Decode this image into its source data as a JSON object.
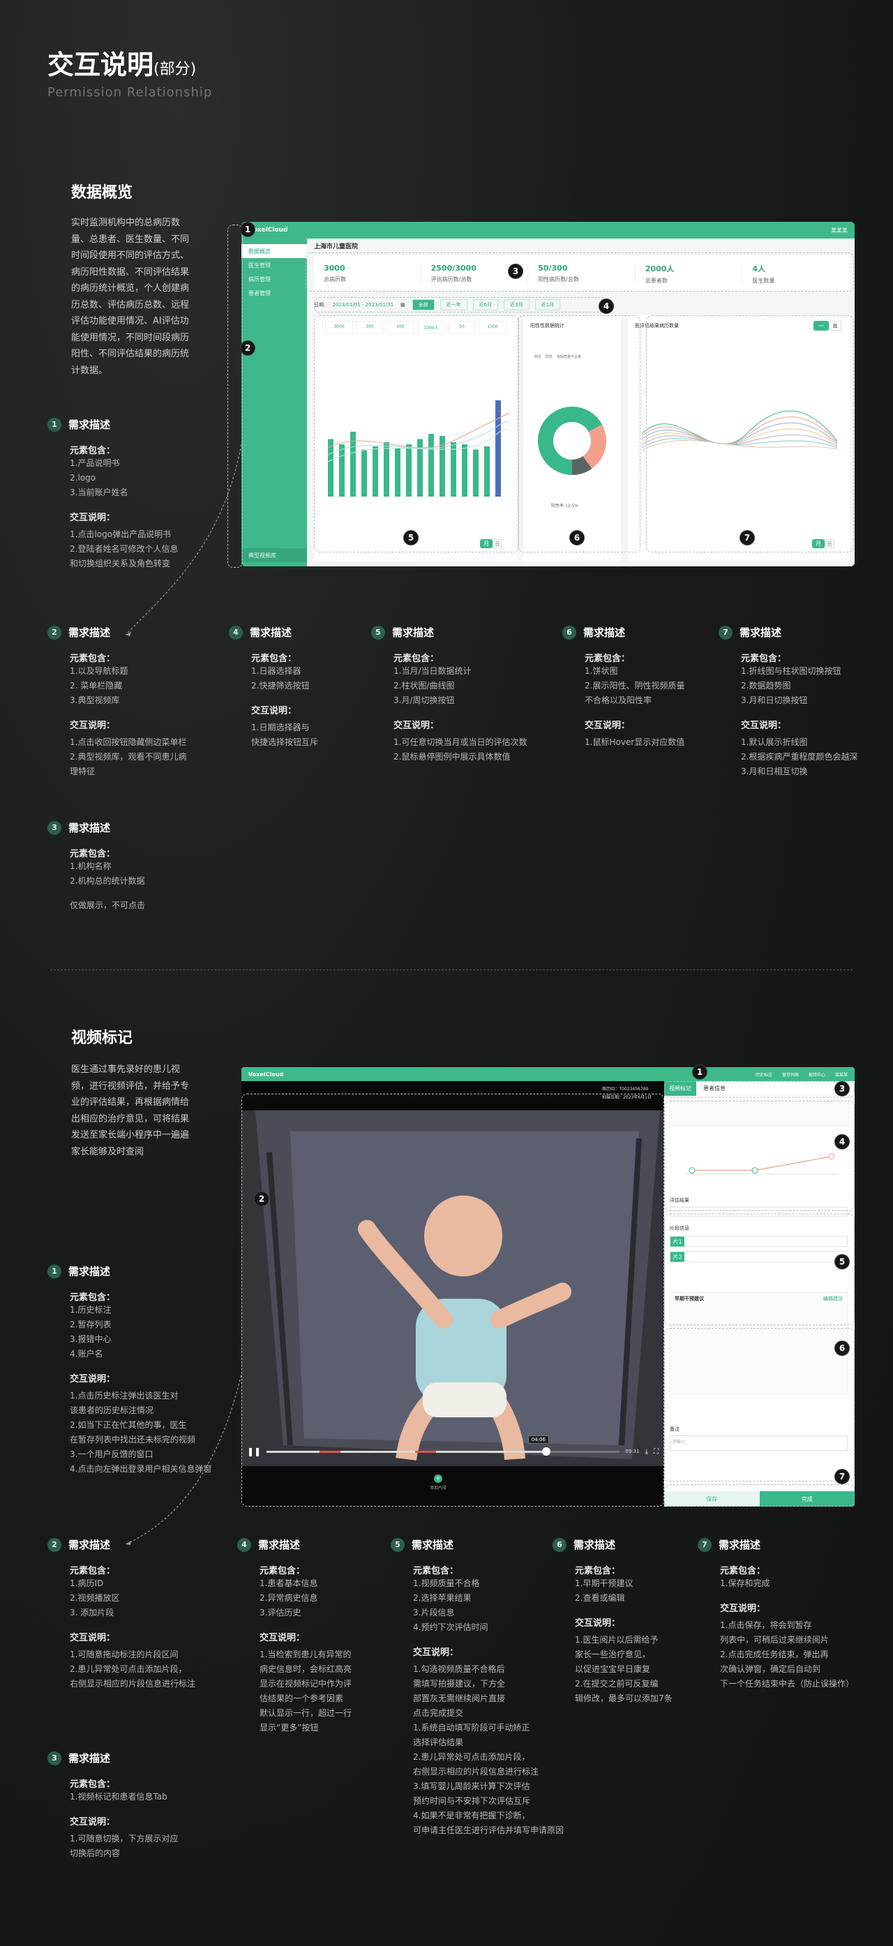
{
  "header": {
    "title": "交互说明",
    "title_suffix": "(部分)",
    "subtitle": "Permission Relationship"
  },
  "overview": {
    "title": "数据概览",
    "intro": [
      "实时监测机构中的总病历数",
      "量、总患者、医生数量、不同",
      "时间段使用不同的评估方式、",
      "病历阳性数据、不同评估结果",
      "的病历统计概览，个人创建病",
      "历总数、评估病历总数、远程",
      "评估功能使用情况、AI评估功",
      "能使用情况，不同时间段病历",
      "阳性、不同评估结果的病历统",
      "计数据。"
    ],
    "reqs": [
      {
        "n": "1",
        "title": "需求描述",
        "h1": "元素包含：",
        "items": [
          "1.产品说明书",
          "2.logo",
          "3.当前账户姓名"
        ],
        "h2": "交互说明：",
        "notes": [
          "1.点击logo弹出产品说明书",
          "2.登陆者姓名可修改个人信息",
          "和切换组织关系及角色转变"
        ]
      },
      {
        "n": "2",
        "title": "需求描述",
        "h1": "元素包含：",
        "items": [
          "1.以及导航标题",
          "2. 菜单栏隐藏",
          "3.典型视频库"
        ],
        "h2": "交互说明：",
        "notes": [
          "1.点击收回按钮隐藏侧边菜单栏",
          "2.典型视频库，观看不同患儿病",
          "理特征"
        ]
      },
      {
        "n": "3",
        "title": "需求描述",
        "h1": "元素包含：",
        "items": [
          "1.机构名称",
          "2.机构总的统计数据"
        ],
        "h2": "",
        "notes": [
          "仅做展示，不可点击"
        ]
      },
      {
        "n": "4",
        "title": "需求描述",
        "h1": "元素包含：",
        "items": [
          "1.日器选择器",
          "2.快捷筛选按钮"
        ],
        "h2": "交互说明：",
        "notes": [
          "1.日期选择器与",
          "快捷选择按钮互斥"
        ]
      },
      {
        "n": "5",
        "title": "需求描述",
        "h1": "元素包含：",
        "items": [
          "1.当月/当日数据统计",
          "2.柱状图/曲线图",
          "3.月/周切换按钮"
        ],
        "h2": "交互说明：",
        "notes": [
          "1.可任意切换当月或当日的评估次数",
          "2.鼠标悬停图例中展示具体数值"
        ]
      },
      {
        "n": "6",
        "title": "需求描述",
        "h1": "元素包含：",
        "items": [
          "1.饼状图",
          "2.展示阳性、阴性视频质量",
          "不合格以及阳性率"
        ],
        "h2": "交互说明：",
        "notes": [
          "1.鼠标Hover显示对应数值"
        ]
      },
      {
        "n": "7",
        "title": "需求描述",
        "h1": "元素包含：",
        "items": [
          "1.折线图与柱状图切换按钮",
          "2.数据趋势图",
          "3.月和日切换按钮"
        ],
        "h2": "交互说明：",
        "notes": [
          "1.默认展示折线图",
          "2.根据疾病严重程度颜色会越深",
          "3.月和日相互切换"
        ]
      }
    ],
    "screen": {
      "logo": "VoxelCloud",
      "user": "某某某",
      "org": "上海市儿童医院",
      "sidebar": [
        "数据概览",
        "医生管理",
        "病历管理",
        "患者管理"
      ],
      "sidebar_footer": "典型视频库",
      "stats": [
        {
          "v": "3000",
          "l": "总病历数"
        },
        {
          "v": "2500/3000",
          "l": "评估病历数/总数"
        },
        {
          "v": "50/300",
          "l": "阳性病历数/总数"
        },
        {
          "v": "2000人",
          "l": "总患者数"
        },
        {
          "v": "4人",
          "l": "医生数量"
        }
      ],
      "date_label": "日期:",
      "date_range": "2023/01/01 - 2023/01/31",
      "quick": [
        "全部",
        "近一年",
        "近6月",
        "近3月",
        "近1月"
      ],
      "panel1_stats": [
        "3000",
        "300",
        "200",
        "1000人",
        "50",
        "1500"
      ],
      "panel2_title": "阳性性数据统计",
      "panel2_legend": [
        "阴性",
        "阳性",
        "视频质量不合格"
      ],
      "panel2_rate": "阳性率 12.5%",
      "panel3_title": "医评估结果病历数量",
      "btn_month": "月",
      "btn_day": "日"
    }
  },
  "video": {
    "title": "视频标记",
    "intro": [
      "医生通过事先录好的患儿视",
      "频，进行视频评估，并给予专",
      "业的评估结果，再根据病情给",
      "出相应的治疗意见，可将结果",
      "发送至家长端小程序中一遍遍",
      "家长能够及时查阅"
    ],
    "reqs": [
      {
        "n": "1",
        "title": "需求描述",
        "h1": "元素包含：",
        "items": [
          "1.历史标注",
          "2.暂存列表",
          "3.报错中心",
          "4.账户名"
        ],
        "h2": "交互说明：",
        "notes": [
          "1.点击历史标注弹出该医生对",
          "该患者的历史标注情况",
          "2.如当下正在忙其他的事，医生",
          "在暂存列表中找出还未标完的视频",
          "3.一个用户反馈的窗口",
          "4.点击向左弹出登录用户相关信息弹窗"
        ]
      },
      {
        "n": "2",
        "title": "需求描述",
        "h1": "元素包含：",
        "items": [
          "1.病历ID",
          "2.视频播放区",
          "3. 添加片段"
        ],
        "h2": "交互说明：",
        "notes": [
          "1.可随意拖动标注的片段区间",
          "2.患儿异常处可点击添加片段，",
          "右侧显示相应的片段信息进行标注"
        ]
      },
      {
        "n": "3",
        "title": "需求描述",
        "h1": "元素包含：",
        "items": [
          "1.视频标记和患者信息Tab"
        ],
        "h2": "交互说明：",
        "notes": [
          "1.可随意切换，下方展示对应",
          "切换后的内容"
        ]
      },
      {
        "n": "4",
        "title": "需求描述",
        "h1": "元素包含：",
        "items": [
          "1.患者基本信息",
          "2.异常病史信息",
          "3.评估历史"
        ],
        "h2": "交互说明：",
        "notes": [
          "1.当检索到患儿有异常的",
          "病史信息时，会标红高亮",
          "显示在视频标记中作为评",
          "估结果的一个参考因素",
          "默认显示一行，超过一行",
          "显示“更多”按钮"
        ]
      },
      {
        "n": "5",
        "title": "需求描述",
        "h1": "元素包含：",
        "items": [
          "1.视频质量不合格",
          "2.选择苹果结果",
          "3.片段信息",
          "4.预约下次评估时间"
        ],
        "h2": "交互说明：",
        "notes": [
          "1.勾选视频质量不合格后",
          "需填写拍摄建议，下方全",
          "部置灰无需继续阅片直接",
          "点击完成提交",
          "1.系统自动填写阶段可手动矫正",
          "选择评估结果",
          "2.患儿异常处可点击添加片段，",
          "右侧显示相应的片段信息进行标注",
          "3.填写婴儿周龄来计算下次评估",
          "预约时间与不安排下次评估互斥",
          "4.如果不是非常有把握下诊断，",
          "可申请主任医生进行评估并填写申请原因"
        ]
      },
      {
        "n": "6",
        "title": "需求描述",
        "h1": "元素包含：",
        "items": [
          "1.早期干预建议",
          "2.查看或编辑"
        ],
        "h2": "交互说明：",
        "notes": [
          "1.医生阅片以后需给予",
          "家长一些治疗意见，",
          "以促进宝宝早日康复",
          "2.在提交之前可反复编",
          "辑修改，最多可以添加7条"
        ]
      },
      {
        "n": "7",
        "title": "需求描述",
        "h1": "元素包含：",
        "items": [
          "1.保存和完成"
        ],
        "h2": "交互说明：",
        "notes": [
          "1.点击保存，将会到暂存",
          "列表中，可稍后过来继续阅片",
          "2.点击完成任务结束，弹出再",
          "次确认弹窗，确定后自动到",
          "下一个任务结束中去（防止误操作）"
        ]
      }
    ],
    "screen": {
      "logo": "VoxelCloud",
      "top_actions": [
        "历史标注",
        "暂存列表",
        "报错中心",
        "某某某"
      ],
      "case_id": "病历ID：T0023456789",
      "shoot_time": "拍摄日期：2023年6月1日",
      "tabs": [
        "视频标记",
        "患者信息"
      ],
      "time_tip": "04:06",
      "time_end": "09:31",
      "add_segment": "添加片段",
      "eval_result": "评估结果",
      "segment_info": "片段信息",
      "advice_title": "早期干预建议",
      "advice_edit": "编辑建议",
      "remark": "备注",
      "remark_ph": "请输入",
      "save": "保存",
      "done": "完成"
    }
  }
}
